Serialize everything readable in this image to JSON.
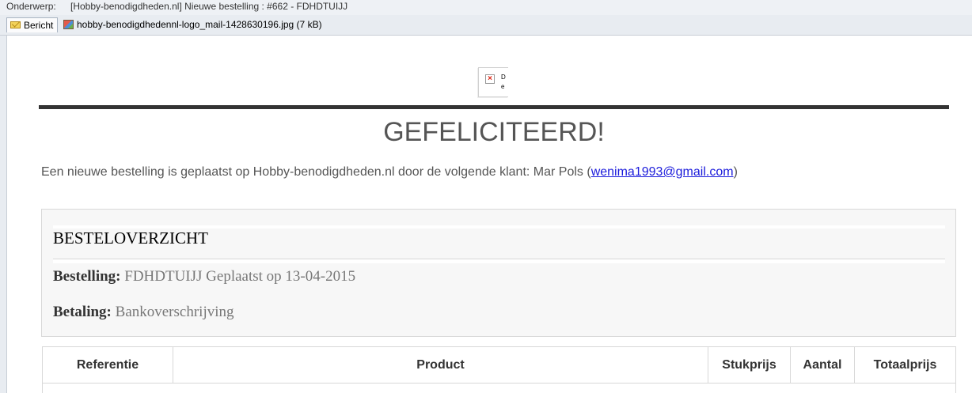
{
  "subject": {
    "label": "Onderwerp:",
    "value": "[Hobby-benodigdheden.nl] Nieuwe bestelling : #662 - FDHDTUIJJ"
  },
  "attachments": {
    "message_tab": "Bericht",
    "file": "hobby-benodigdhedennl-logo_mail-1428630196.jpg (7 kB)"
  },
  "email": {
    "logo_alt": "D e",
    "headline": "GEFELICITEERD!",
    "intro_text": "Een nieuwe bestelling is geplaatst op Hobby-benodigdheden.nl door de volgende klant: Mar Pols (",
    "customer_email": "wenima1993@gmail.com",
    "intro_close": ")",
    "overview": {
      "title": "BESTELOVERZICHT",
      "order_label": "Bestelling:",
      "order_value": "FDHDTUIJJ Geplaatst op 13-04-2015",
      "payment_label": "Betaling:",
      "payment_value": "Bankoverschrijving"
    },
    "table_headers": [
      "Referentie",
      "Product",
      "Stukprijs",
      "Aantal",
      "Totaalprijs"
    ]
  },
  "colors": {
    "link": "#1a1adb",
    "heading": "#555555",
    "rule": "#333333"
  }
}
